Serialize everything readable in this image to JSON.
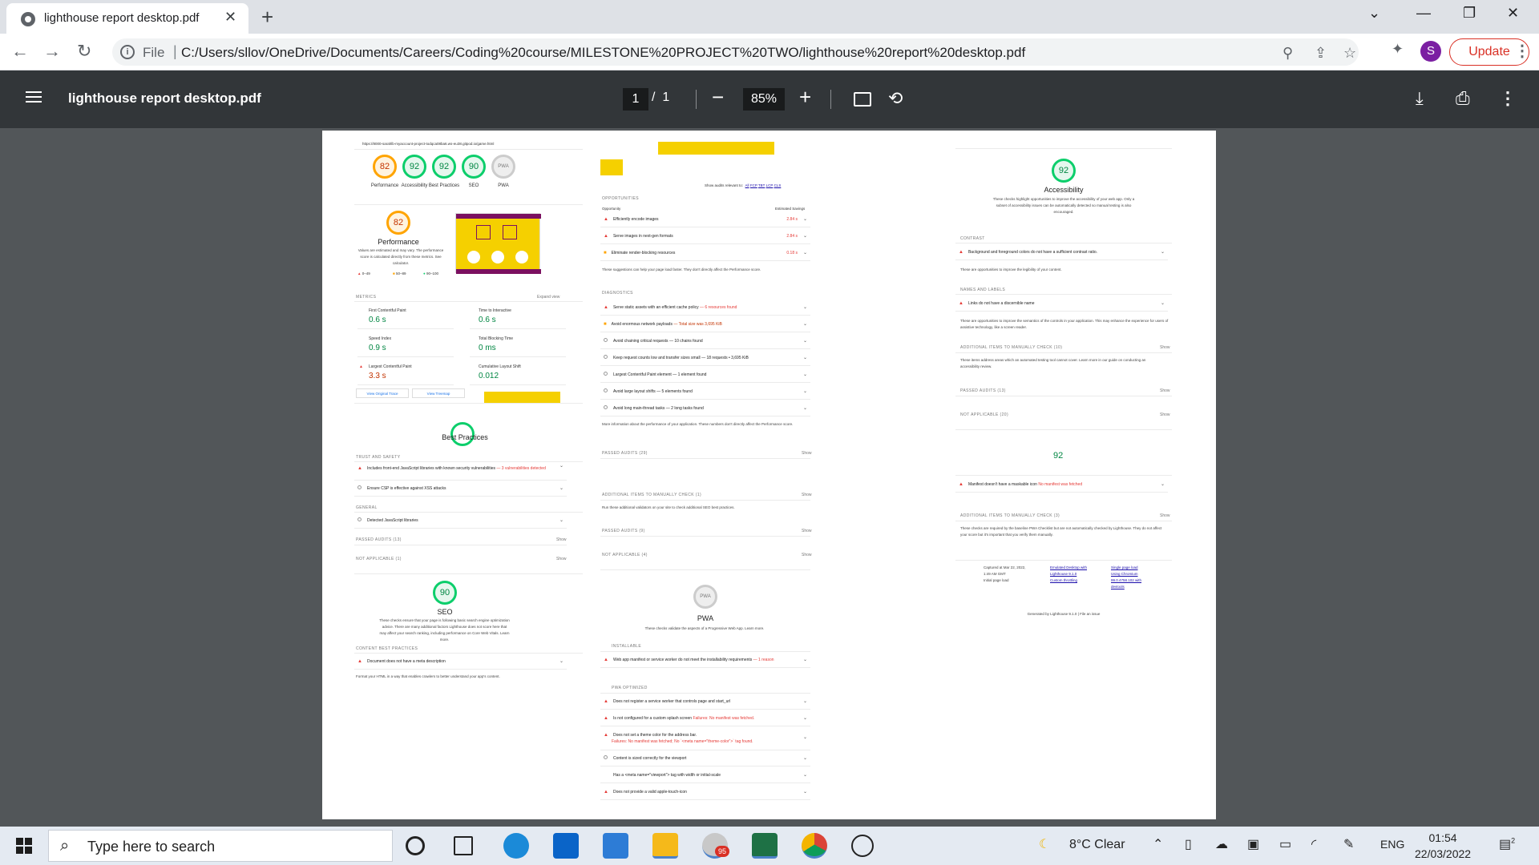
{
  "browser": {
    "tab_title": "lighthouse report desktop.pdf",
    "url_scheme": "File",
    "url": "C:/Users/sllov/OneDrive/Documents/Careers/Coding%20course/MILESTONE%20PROJECT%20TWO/lighthouse%20report%20desktop.pdf",
    "profile_initial": "S",
    "update_label": "Update"
  },
  "pdf_viewer": {
    "title": "lighthouse report desktop.pdf",
    "current_page": "1",
    "total_pages": "1",
    "page_separator": "/",
    "zoom": "85%"
  },
  "report": {
    "url_line": "https://8000-sarahlb-myaccount-project-todqca08ba6.ws-eu38.gitpod.io/game.html",
    "summary": [
      {
        "score": "82",
        "label": "Performance"
      },
      {
        "score": "92",
        "label": "Accessibility"
      },
      {
        "score": "92",
        "label": "Best Practices"
      },
      {
        "score": "90",
        "label": "SEO"
      },
      {
        "score": "PWA",
        "label": "PWA"
      }
    ],
    "performance": {
      "score": "82",
      "title": "Performance",
      "note": "Values are estimated and may vary. The performance score is calculated directly from these metrics. See calculator.",
      "legend": [
        "0–49",
        "50–89",
        "90–100"
      ],
      "metrics_label": "METRICS",
      "expand_label": "Expand view",
      "metrics": [
        {
          "name": "First Contentful Paint",
          "value": "0.6 s"
        },
        {
          "name": "Time to Interactive",
          "value": "0.6 s"
        },
        {
          "name": "Speed Index",
          "value": "0.9 s"
        },
        {
          "name": "Total Blocking Time",
          "value": "0 ms"
        },
        {
          "name": "Largest Contentful Paint",
          "value": "3.3 s"
        },
        {
          "name": "Cumulative Layout Shift",
          "value": "0.012"
        }
      ],
      "view_trace": "View Original Trace",
      "view_treemap": "View Treemap"
    },
    "best_practices": {
      "title": "Best Practices",
      "trust_label": "TRUST AND SAFETY",
      "item1": "Includes front-end JavaScript libraries with known security vulnerabilities",
      "item1_extra": "— 3 vulnerabilities detected",
      "item2": "Ensure CSP is effective against XSS attacks",
      "general_label": "GENERAL",
      "item3": "Detected JavaScript libraries",
      "passed": "PASSED AUDITS (13)",
      "not_applicable": "NOT APPLICABLE (1)",
      "show": "Show"
    },
    "seo": {
      "score": "90",
      "title": "SEO",
      "desc": "These checks ensure that your page is following basic search engine optimization advice. There are many additional factors Lighthouse does not score here that may affect your search ranking, including performance on Core Web Vitals. Learn more.",
      "content_label": "CONTENT BEST PRACTICES",
      "item1": "Document does not have a meta description",
      "footer": "Format your HTML in a way that enables crawlers to better understand your app's content."
    },
    "middle": {
      "show_audits": "Show audits relevant to:",
      "filters": [
        "All",
        "FCP",
        "TBT",
        "LCP",
        "CLS"
      ],
      "opportunities_label": "OPPORTUNITIES",
      "opportunity_col": "Opportunity",
      "savings_col": "Estimated Savings",
      "opportunities": [
        {
          "name": "Efficiently encode images",
          "value": "2.84 s"
        },
        {
          "name": "Serve images in next-gen formats",
          "value": "2.84 s"
        },
        {
          "name": "Eliminate render-blocking resources",
          "value": "0.18 s"
        }
      ],
      "opp_note": "These suggestions can help your page load faster. They don't directly affect the Performance score.",
      "diagnostics_label": "DIAGNOSTICS",
      "diagnostics": [
        {
          "name": "Serve static assets with an efficient cache policy",
          "extra": "— 6 resources found"
        },
        {
          "name": "Avoid enormous network payloads",
          "extra": "— Total size was 3,695 KiB"
        },
        {
          "name": "Avoid chaining critical requests",
          "extra": "— 10 chains found"
        },
        {
          "name": "Keep request counts low and transfer sizes small",
          "extra": "— 18 requests • 3,695 KiB"
        },
        {
          "name": "Largest Contentful Paint element",
          "extra": "— 1 element found"
        },
        {
          "name": "Avoid large layout shifts",
          "extra": "— 5 elements found"
        },
        {
          "name": "Avoid long main-thread tasks",
          "extra": "— 2 long tasks found"
        }
      ],
      "diag_note": "More information about the performance of your application. These numbers don't directly affect the Performance score.",
      "passed": "PASSED AUDITS (29)",
      "manual_check": "ADDITIONAL ITEMS TO MANUALLY CHECK (1)",
      "manual_note": "Run these additional validators on your site to check additional SEO best practices.",
      "seo_passed": "PASSED AUDITS (9)",
      "seo_na": "NOT APPLICABLE (4)",
      "show": "Show"
    },
    "pwa": {
      "badge": "PWA",
      "title": "PWA",
      "desc": "These checks validate the aspects of a Progressive Web App. Learn more.",
      "installable_label": "INSTALLABLE",
      "installable_item": "Web app manifest or service worker do not meet the installability requirements",
      "installable_extra": "— 1 reason",
      "optimized_label": "PWA OPTIMIZED",
      "items": [
        {
          "name": "Does not register a service worker that controls page and start_url",
          "extra": ""
        },
        {
          "name": "Is not configured for a custom splash screen",
          "extra": "Failures: No manifest was fetched."
        },
        {
          "name": "Does not set a theme color for the address bar.",
          "extra": "Failures: No manifest was fetched; No `<meta name=\"theme-color\">` tag found."
        },
        {
          "name": "Content is sized correctly for the viewport",
          "extra": ""
        },
        {
          "name": "Has a <meta name=\"viewport\"> tag with width or initial-scale",
          "extra": ""
        },
        {
          "name": "Does not provide a valid apple-touch-icon",
          "extra": ""
        }
      ]
    },
    "accessibility": {
      "score": "92",
      "title": "Accessibility",
      "desc": "These checks highlight opportunities to improve the accessibility of your web app. Only a subset of accessibility issues can be automatically detected so manual testing is also encouraged.",
      "contrast_label": "CONTRAST",
      "contrast_item": "Background and foreground colors do not have a sufficient contrast ratio.",
      "contrast_note": "These are opportunities to improve the legibility of your content.",
      "names_label": "NAMES AND LABELS",
      "names_item": "Links do not have a discernible name",
      "names_note": "These are opportunities to improve the semantics of the controls in your application. This may enhance the experience for users of assistive technology, like a screen reader.",
      "manual_label": "ADDITIONAL ITEMS TO MANUALLY CHECK (10)",
      "manual_note": "These items address areas which an automated testing tool cannot cover. Learn more in our guide on conducting an accessibility review.",
      "passed": "PASSED AUDITS (13)",
      "na": "NOT APPLICABLE (20)",
      "show": "Show",
      "seo_score_repeat": "92",
      "manifest_item": "Manifest doesn't have a maskable icon",
      "manifest_extra": "No manifest was fetched",
      "manual3": "ADDITIONAL ITEMS TO MANUALLY CHECK (3)",
      "manual3_note": "These checks are required by the baseline PWA Checklist but are not automatically checked by Lighthouse. They do not affect your score but it's important that you verify them manually.",
      "captured": "Captured at Mar 22, 2022, 1:49 AM GMT",
      "initial": "Initial page load",
      "emulated": "Emulated Desktop with Lighthouse 9.1.0",
      "custom": "Custom throttling",
      "single": "Single page load",
      "chromium": "Using Chromium 99.0.4758.102 with devtools",
      "generated": "Generated by Lighthouse 9.1.0 | File an issue"
    }
  },
  "taskbar": {
    "search_placeholder": "Type here to search",
    "weather": "8°C  Clear",
    "language": "ENG",
    "time": "01:54",
    "date": "22/03/2022",
    "badge": "95",
    "notification_count": "2"
  },
  "colors": {
    "pass": "#0cce6b",
    "average": "#ffa400",
    "fail": "#e53935",
    "accent": "#1a73e8"
  }
}
